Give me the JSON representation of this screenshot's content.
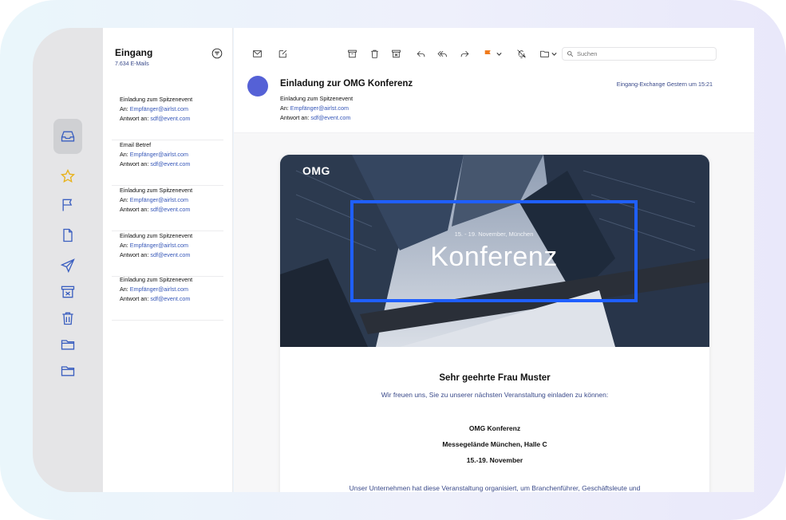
{
  "list": {
    "title": "Eingang",
    "count": "7.634 E-Mails",
    "items": [
      {
        "subject": "Einladung zum Spitzenevent",
        "to_label": "An:",
        "to": "Empfänger@airlst.com",
        "reply_label": "Antwort an:",
        "reply": "sdf@event.com"
      },
      {
        "subject": "Email Betref",
        "to_label": "An:",
        "to": "Empfänger@airlst.com",
        "reply_label": "Antwort an:",
        "reply": "sdf@event.com"
      },
      {
        "subject": "Einladung zum Spitzenevent",
        "to_label": "An:",
        "to": "Empfänger@airlst.com",
        "reply_label": "Antwort an:",
        "reply": "sdf@event.com"
      },
      {
        "subject": "Einladung zum Spitzenevent",
        "to_label": "An:",
        "to": "Empfänger@airlst.com",
        "reply_label": "Antwort an:",
        "reply": "sdf@event.com"
      },
      {
        "subject": "Einladung zum Spitzenevent",
        "to_label": "An:",
        "to": "Empfänger@airlst.com",
        "reply_label": "Antwort an:",
        "reply": "sdf@event.com"
      }
    ]
  },
  "toolbar": {
    "search_placeholder": "Suchen",
    "flag_color": "#f07a1a"
  },
  "message": {
    "title": "Einladung zur OMG Konferenz",
    "subject": "Einladung zum Spitzenevent",
    "to_label": "An:",
    "to": "Empfänger@airlst.com",
    "reply_label": "Antwort an:",
    "reply": "sdf@event.com",
    "folder_time": "Eingang-Exchange Gestern um 15:21",
    "avatar_color": "#5561d6"
  },
  "email": {
    "logo": "OMG",
    "banner_date": "15. - 19. November, München",
    "banner_heading": "Konferenz",
    "accent_color": "#1f5fff",
    "greeting": "Sehr geehrte Frau Muster",
    "intro": "Wir freuen uns, Sie zu unserer nächsten Veranstaltung einladen zu können:",
    "event_name": "OMG Konferenz",
    "event_place": "Messegelände München, Halle C",
    "event_dates": "15.-19. November",
    "body_partial": "Unser Unternehmen hat diese Veranstaltung organisiert, um Branchenführer, Geschäftsleute und"
  }
}
